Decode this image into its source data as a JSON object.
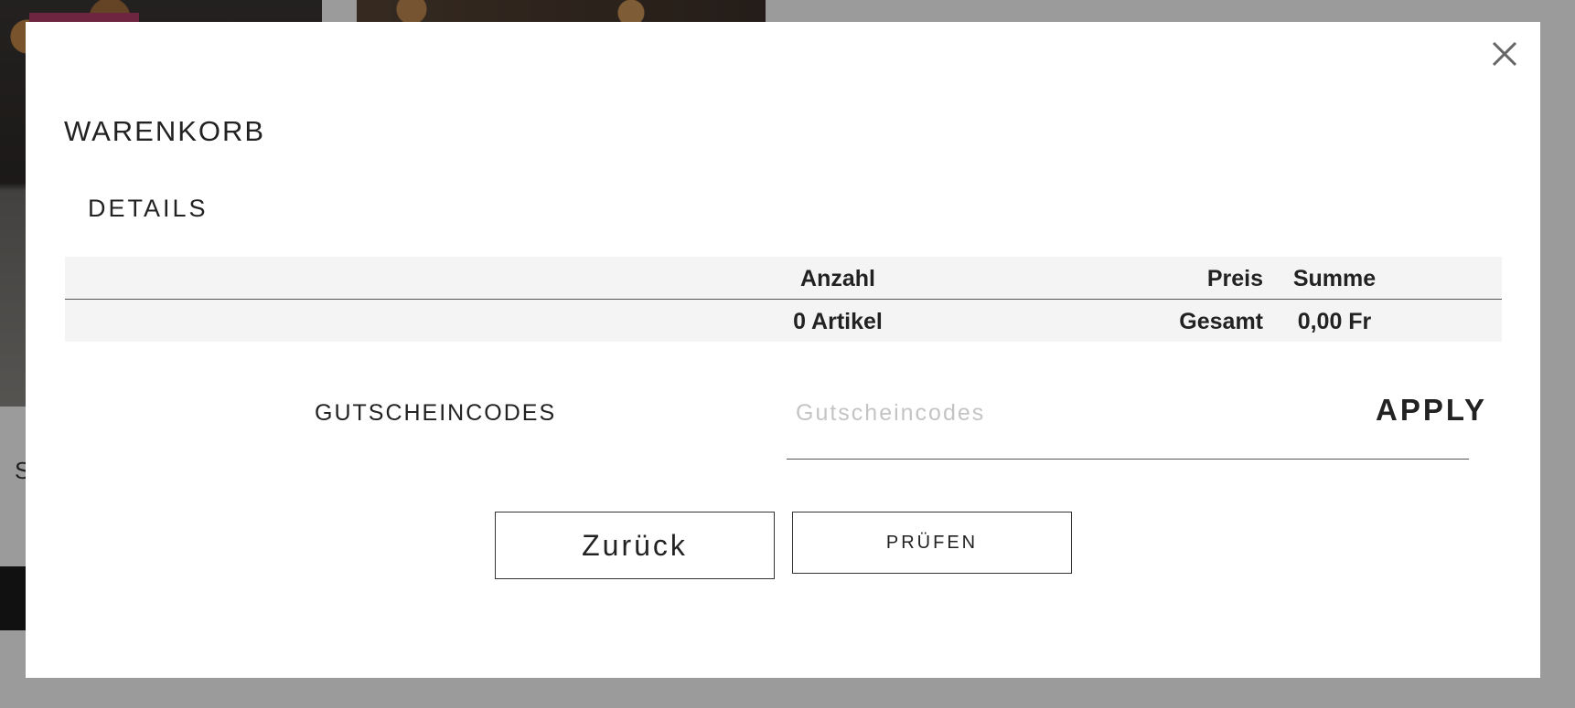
{
  "modal": {
    "title": "WARENKORB",
    "section_title": "DETAILS",
    "table": {
      "headers": {
        "quantity": "Anzahl",
        "price": "Preis",
        "sum": "Summe"
      },
      "footer": {
        "quantity": "0 Artikel",
        "price": "Gesamt",
        "sum": "0,00 Fr"
      }
    },
    "voucher": {
      "label": "GUTSCHEINCODES",
      "placeholder": "Gutscheincodes",
      "apply_label": "APPLY"
    },
    "buttons": {
      "back": "Zurück",
      "check": "PRÜFEN"
    }
  },
  "background": {
    "partial_text": "S"
  },
  "icons": {
    "close": "close-icon"
  },
  "colors": {
    "overlay": "#9b9b9b",
    "table_bg": "#f4f4f4",
    "text": "#222222",
    "placeholder": "#c4c4c4"
  }
}
